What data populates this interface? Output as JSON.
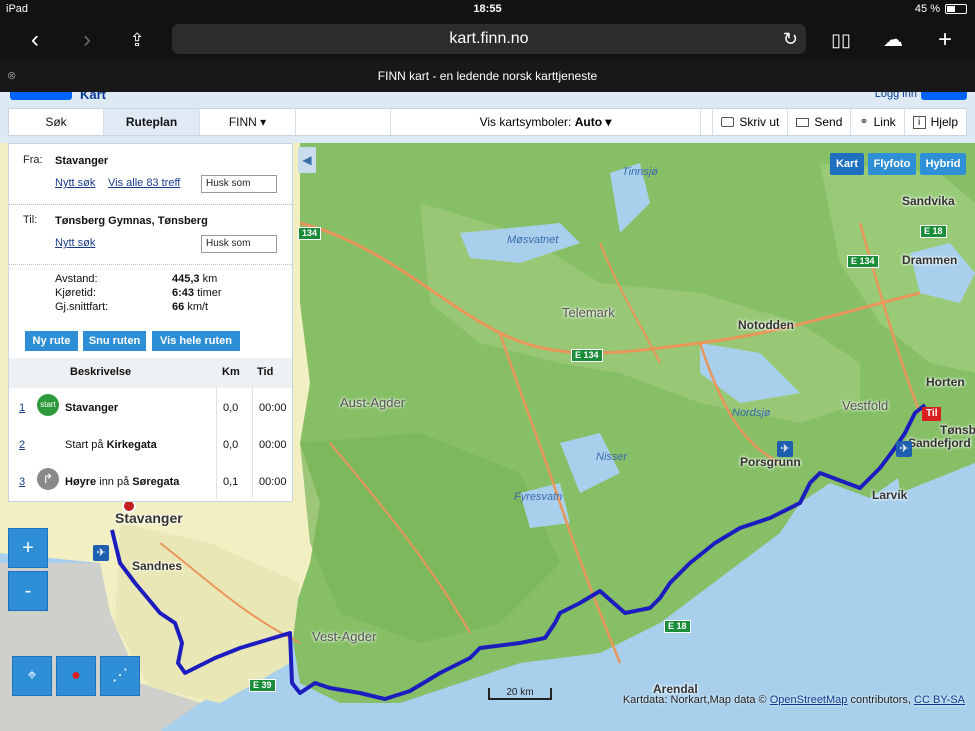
{
  "status": {
    "device": "iPad",
    "time": "18:55",
    "battery": "45 %"
  },
  "browser": {
    "url": "kart.finn.no",
    "tab_title": "FINN kart - en ledende norsk karttjeneste"
  },
  "header": {
    "brand": "Kart",
    "login": "Logg inn"
  },
  "nav": {
    "tabs": [
      "Søk",
      "Ruteplan",
      "FINN ▾"
    ],
    "symbols_label": "Vis kartsymboler:",
    "symbols_value": "Auto ▾",
    "actions": {
      "print": "Skriv ut",
      "send": "Send",
      "link": "Link",
      "help": "Hjelp"
    }
  },
  "map_types": [
    "Kart",
    "Flyfoto",
    "Hybrid"
  ],
  "route": {
    "from_label": "Fra:",
    "from": "Stavanger",
    "from_links": {
      "new_search": "Nytt søk",
      "show_all": "Vis alle 83 treff"
    },
    "remember": "Husk som",
    "to_label": "Til:",
    "to": "Tønsberg Gymnas, Tønsberg",
    "to_links": {
      "new_search": "Nytt søk"
    },
    "stats": {
      "distance_label": "Avstand:",
      "distance": "445,3",
      "distance_unit": "km",
      "time_label": "Kjøretid:",
      "time": "6:43",
      "time_unit": "timer",
      "speed_label": "Gj.snittfart:",
      "speed": "66",
      "speed_unit": "km/t"
    },
    "buttons": {
      "new_route": "Ny rute",
      "reverse": "Snu ruten",
      "show_all": "Vis hele ruten"
    },
    "steps_header": {
      "desc": "Beskrivelse",
      "km": "Km",
      "tid": "Tid"
    },
    "steps": [
      {
        "num": "1",
        "icon": "start",
        "desc_bold": "Stavanger",
        "km": "0,0",
        "tid": "00:00"
      },
      {
        "num": "2",
        "icon": "",
        "desc_plain": "Start på ",
        "desc_bold": "Kirkegata",
        "km": "0,0",
        "tid": "00:00"
      },
      {
        "num": "3",
        "icon": "turn-right-icon",
        "desc_bold": "Høyre",
        "desc_plain": " inn på ",
        "desc_bold2": "Søregata",
        "km": "0,1",
        "tid": "00:00"
      }
    ]
  },
  "map_labels": {
    "places": [
      "Sandvika",
      "Drammen",
      "Notodden",
      "Horten",
      "Tønsb",
      "Sandefjord",
      "Larvik",
      "Porsgrunn",
      "Stavanger",
      "Sandnes",
      "Arendal"
    ],
    "regions": [
      "Telemark",
      "Aust-Agder",
      "Vest-Agder",
      "Vestfold"
    ],
    "water": [
      "Tinnsjø",
      "Møsvatnet",
      "Nordsjø",
      "Nisser",
      "Fyresvatn"
    ],
    "roads": [
      "E 18",
      "E 134",
      "E 134",
      "E 18",
      "E 39",
      "134"
    ],
    "end_marker": "Til"
  },
  "scale": "20 km",
  "attribution": {
    "prefix": "Kartdata: Norkart,Map data ©",
    "osm": "OpenStreetMap",
    "middle": "contributors,",
    "license": "CC BY-SA"
  },
  "colors": {
    "accent": "#2f8fd6",
    "route": "#1d1dbf",
    "land": "#7fba5f",
    "water": "#a8d0ec"
  }
}
